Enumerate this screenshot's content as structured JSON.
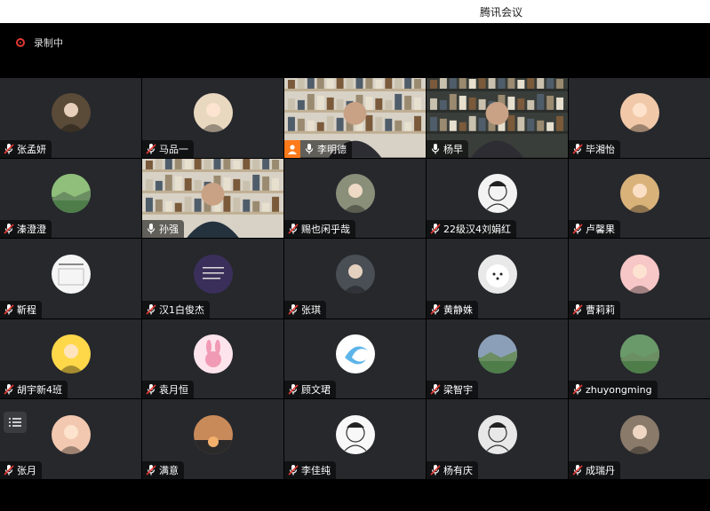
{
  "window": {
    "title": "腾讯会议"
  },
  "recording": {
    "label": "录制中",
    "color": "#e53935"
  },
  "participants": [
    {
      "name": "张孟妍",
      "kind": "avatar",
      "color": "#5a4a38",
      "icon": "avatar-photo-icon",
      "mic": "muted"
    },
    {
      "name": "马品一",
      "kind": "avatar",
      "color": "#e9d8c0",
      "icon": "avatar-cartoon-icon",
      "mic": "muted"
    },
    {
      "name": "李明德",
      "kind": "video",
      "mic": "on",
      "host": true
    },
    {
      "name": "杨早",
      "kind": "video",
      "mic": "on"
    },
    {
      "name": "毕湘怡",
      "kind": "avatar",
      "color": "#f1c9a8",
      "icon": "avatar-baby-icon",
      "mic": "muted"
    },
    {
      "name": "溱澄澄",
      "kind": "avatar",
      "color": "#8fbf7a",
      "icon": "avatar-landscape-icon",
      "mic": "muted"
    },
    {
      "name": "孙强",
      "kind": "video",
      "mic": "on",
      "active": true
    },
    {
      "name": "赐也闲乎哉",
      "kind": "avatar",
      "color": "#8a8f7a",
      "icon": "avatar-photo-icon",
      "mic": "muted"
    },
    {
      "name": "22级汉4刘娟红",
      "kind": "avatar",
      "color": "#f3f3f3",
      "icon": "avatar-sketch-icon",
      "mic": "muted"
    },
    {
      "name": "卢馨果",
      "kind": "avatar",
      "color": "#d9b27a",
      "icon": "avatar-child-icon",
      "mic": "muted"
    },
    {
      "name": "靳程",
      "kind": "avatar",
      "color": "#f5f5f5",
      "icon": "avatar-habit-tracker-icon",
      "mic": "muted"
    },
    {
      "name": "汉1白俊杰",
      "kind": "avatar",
      "color": "#3a2f5a",
      "icon": "avatar-text-icon",
      "mic": "muted"
    },
    {
      "name": "张琪",
      "kind": "avatar",
      "color": "#4a4f55",
      "icon": "avatar-photo-icon",
      "mic": "muted"
    },
    {
      "name": "黄静姝",
      "kind": "avatar",
      "color": "#e9e9e9",
      "icon": "avatar-dog-icon",
      "mic": "muted"
    },
    {
      "name": "曹莉莉",
      "kind": "avatar",
      "color": "#f7c6c6",
      "icon": "avatar-cartoon-icon",
      "mic": "muted"
    },
    {
      "name": "胡宇新4班",
      "kind": "avatar",
      "color": "#ffd84a",
      "icon": "avatar-cartoon-icon",
      "mic": "muted"
    },
    {
      "name": "袁月恒",
      "kind": "avatar",
      "color": "#fde4ec",
      "icon": "avatar-bunny-icon",
      "mic": "muted"
    },
    {
      "name": "顾文珺",
      "kind": "avatar",
      "color": "#5db4e8",
      "icon": "avatar-swirl-icon",
      "mic": "muted"
    },
    {
      "name": "梁智宇",
      "kind": "avatar",
      "color": "#8ba0b8",
      "icon": "avatar-landscape-icon",
      "mic": "muted"
    },
    {
      "name": "zhuyongming",
      "kind": "avatar",
      "color": "#6a9a6a",
      "icon": "avatar-landscape-icon",
      "mic": "muted"
    },
    {
      "name": "张月",
      "kind": "avatar",
      "color": "#f2c8b0",
      "icon": "avatar-child-icon",
      "mic": "muted"
    },
    {
      "name": "满意",
      "kind": "avatar",
      "color": "#c98a5a",
      "icon": "avatar-sunset-icon",
      "mic": "muted"
    },
    {
      "name": "李佳纯",
      "kind": "avatar",
      "color": "#f8f8f8",
      "icon": "avatar-sketch-icon",
      "mic": "muted"
    },
    {
      "name": "杨有庆",
      "kind": "avatar",
      "color": "#e8e8e8",
      "icon": "avatar-sketch-icon",
      "mic": "muted"
    },
    {
      "name": "成瑞丹",
      "kind": "avatar",
      "color": "#8a7a6a",
      "icon": "avatar-photo-icon",
      "mic": "muted"
    }
  ],
  "colors": {
    "tile": "#26282c",
    "host_badge": "#ff7a1a",
    "active_border": "#35c24a",
    "muted": "#e53935"
  }
}
